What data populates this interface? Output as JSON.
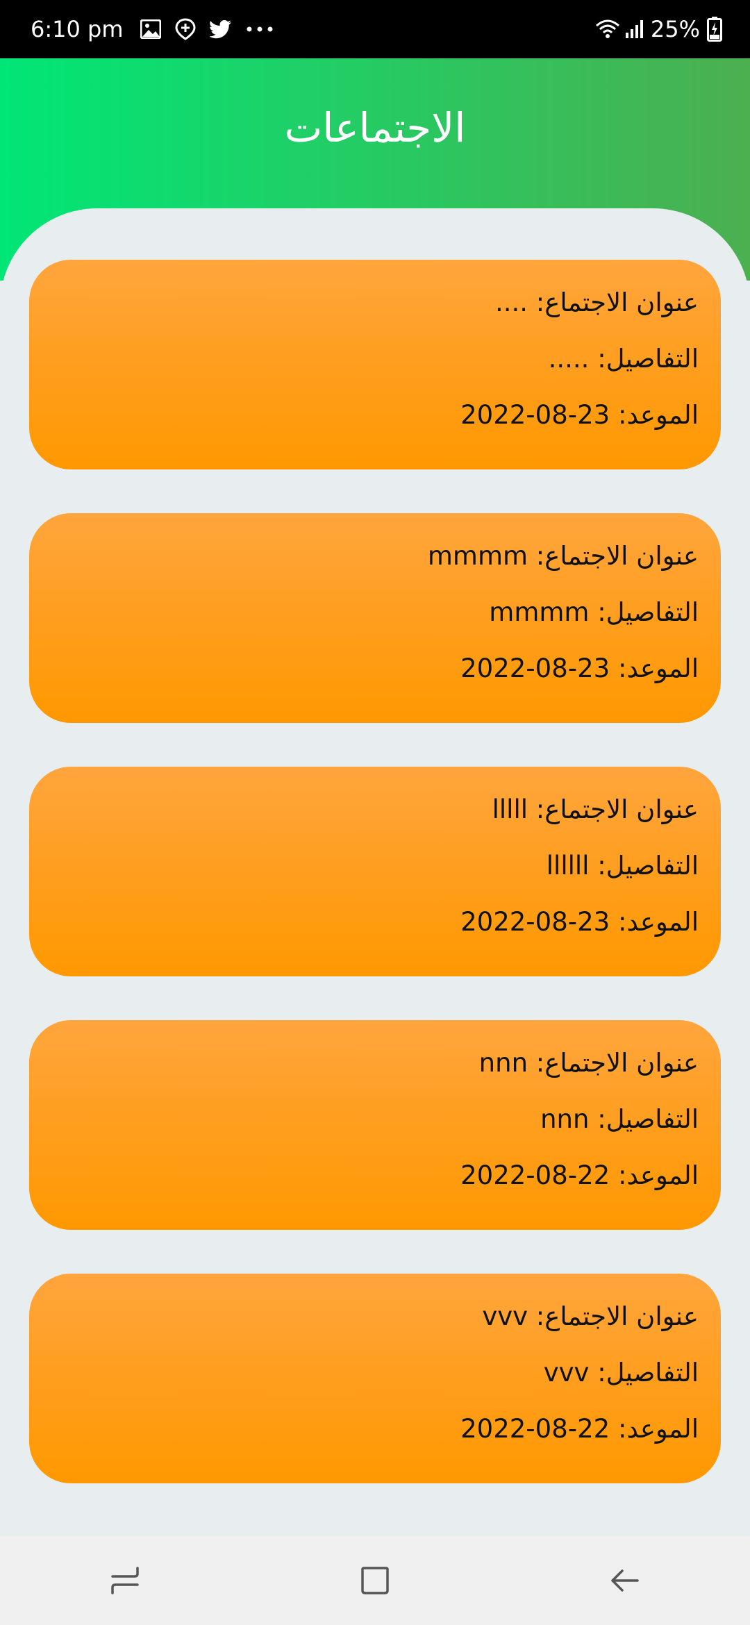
{
  "status_bar": {
    "time": "6:10 pm",
    "battery": "25%",
    "icons": [
      "image-icon",
      "location-plus-icon",
      "twitter-icon",
      "more-dots-icon",
      "wifi-icon",
      "signal-icon",
      "battery-charging-icon"
    ]
  },
  "header": {
    "title": "الاجتماعات"
  },
  "meetings": [
    {
      "title": "عنوان الاجتماع: ....",
      "details": "التفاصيل: .....",
      "date": "الموعد: 23-08-2022"
    },
    {
      "title": "عنوان الاجتماع: mmmm",
      "details": "التفاصيل: mmmm",
      "date": "الموعد: 23-08-2022"
    },
    {
      "title": "عنوان الاجتماع: lllll",
      "details": "التفاصيل: llllll",
      "date": "الموعد: 23-08-2022"
    },
    {
      "title": "عنوان الاجتماع: nnn",
      "details": "التفاصيل: nnn",
      "date": "الموعد: 22-08-2022"
    },
    {
      "title": "عنوان الاجتماع: vvv",
      "details": "التفاصيل: vvv",
      "date": "الموعد: 22-08-2022"
    }
  ],
  "nav_bar": {
    "buttons": [
      "recent-apps-icon",
      "home-icon",
      "back-icon"
    ]
  },
  "colors": {
    "header_gradient_start": "#00e676",
    "header_gradient_end": "#4caf50",
    "card_gradient_top": "#ffa53d",
    "card_gradient_bottom": "#ff9800",
    "background": "#e8edf0"
  }
}
